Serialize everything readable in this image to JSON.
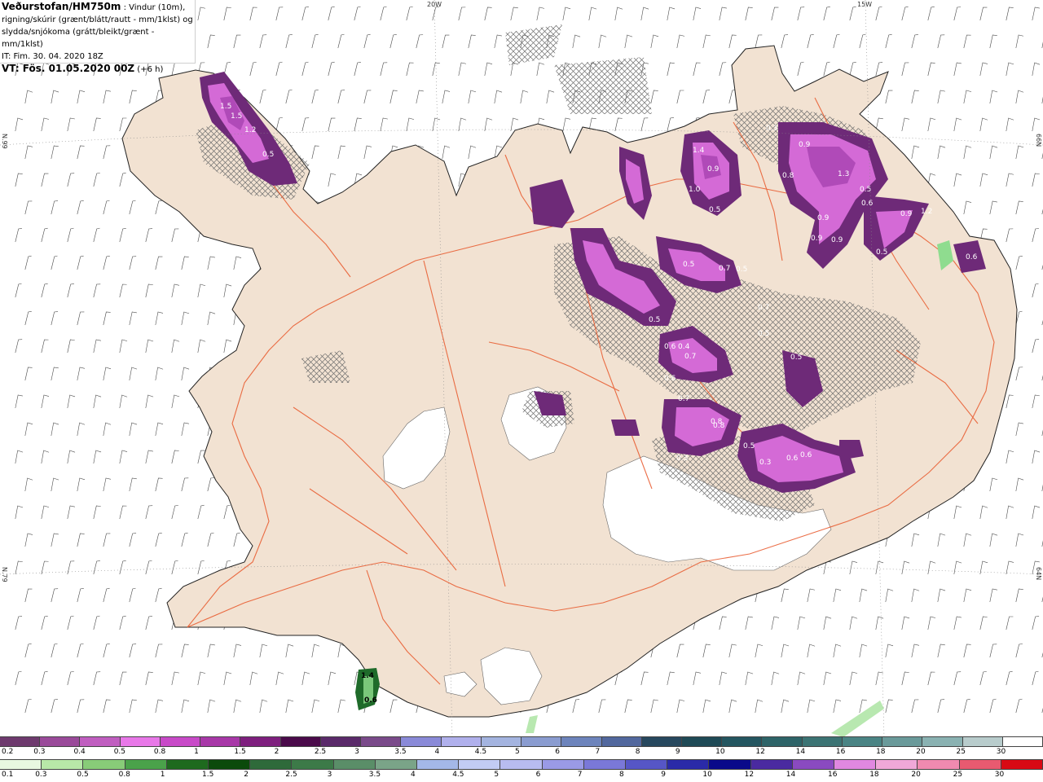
{
  "header": {
    "title": "Veðurstofan/HM750m",
    "line1": " : Vindur (10m),",
    "line2": "rigning/skúrir (grænt/blátt/rautt - mm/1klst) og",
    "line3": "slydda/snjókoma (grátt/bleikt/grænt - mm/1klst)",
    "it": "IT: Fim. 30. 04. 2020 18Z",
    "vt": "VT: Fös. 01.05.2020 00Z",
    "vt_offset": " (+6 h)"
  },
  "grid_labels": {
    "top_20w": "20W",
    "top_15w": "15W",
    "left_66n": "N.99",
    "right_66n": "66N",
    "left_64n": "N.79",
    "right_64n": "64N"
  },
  "colors": {
    "land": "#f2e2d2",
    "glacier": "#ffffff",
    "roads": "#e8572a",
    "wind_barbs": "#4a4a4a",
    "snow_light": "#d46ad6",
    "snow_mid": "#b04ab8",
    "snow_dark": "#6e2a78",
    "rain_green": "#1f6b2a",
    "hatch": "#6e6e6e"
  },
  "snow_labels": [
    "1.5",
    "1.5",
    "1.2",
    "0.5",
    "1.4",
    "0.9",
    "1.0",
    "0.5",
    "0.3",
    "0.9",
    "1.3",
    "0.8",
    "0.9",
    "0.5",
    "0.6",
    "0.9",
    "1.2",
    "0.9",
    "0.5",
    "0.6",
    "0.5",
    "0.7",
    "0.5",
    "0.7",
    "0.5",
    "0.6",
    "0.4",
    "0.6",
    "0.7",
    "0.8",
    "0.5",
    "0.3",
    "0.6",
    "0.6",
    "0.3",
    "0.5",
    "0.7",
    "0.8",
    "0.9",
    "0.5"
  ],
  "rain_labels": [
    "1.4",
    "0.6"
  ],
  "scale_top": {
    "labels": [
      "0.2",
      "0.3",
      "0.4",
      "0.5",
      "0.8",
      "1",
      "1.5",
      "2",
      "2.5",
      "3",
      "3.5",
      "4",
      "4.5",
      "5",
      "6",
      "7",
      "8",
      "9",
      "10",
      "12",
      "14",
      "16",
      "18",
      "20",
      "25",
      "30"
    ],
    "colors": [
      "#6e3a6e",
      "#9a4a9a",
      "#c05ec0",
      "#e878e8",
      "#c84ac8",
      "#a838a8",
      "#7e1f7e",
      "#4a0a4a",
      "#5a2a6a",
      "#7a4a8a",
      "#8a8ad8",
      "#b0b0ec",
      "#a4b4e0",
      "#8a9cd0",
      "#6d84bc",
      "#52689e",
      "#27485e",
      "#1f4a56",
      "#245660",
      "#2e6468",
      "#3c7474",
      "#4a8484",
      "#6a9a9a",
      "#8ab2b2",
      "#b8cccc",
      "#ffffff"
    ]
  },
  "scale_bottom": {
    "labels": [
      "0.1",
      "0.3",
      "0.5",
      "0.8",
      "1",
      "1.5",
      "2",
      "2.5",
      "3",
      "3.5",
      "4",
      "4.5",
      "5",
      "6",
      "7",
      "8",
      "9",
      "10",
      "12",
      "14",
      "16",
      "18",
      "20",
      "25",
      "30"
    ],
    "colors": [
      "#e8f8e0",
      "#b8e8a8",
      "#88cc78",
      "#4aa24a",
      "#1e6a1e",
      "#0b4a0b",
      "#2e6a3a",
      "#3c7a48",
      "#5a8e68",
      "#7aa488",
      "#a4b8e8",
      "#c2ccf4",
      "#b8bcf0",
      "#9a9ae6",
      "#7a78d8",
      "#5656c6",
      "#2a2aa8",
      "#0a0a8a",
      "#4a2aa0",
      "#8a4ac0",
      "#e088e0",
      "#f0a8d8",
      "#f08ab0",
      "#e85a70",
      "#d80a14"
    ]
  }
}
